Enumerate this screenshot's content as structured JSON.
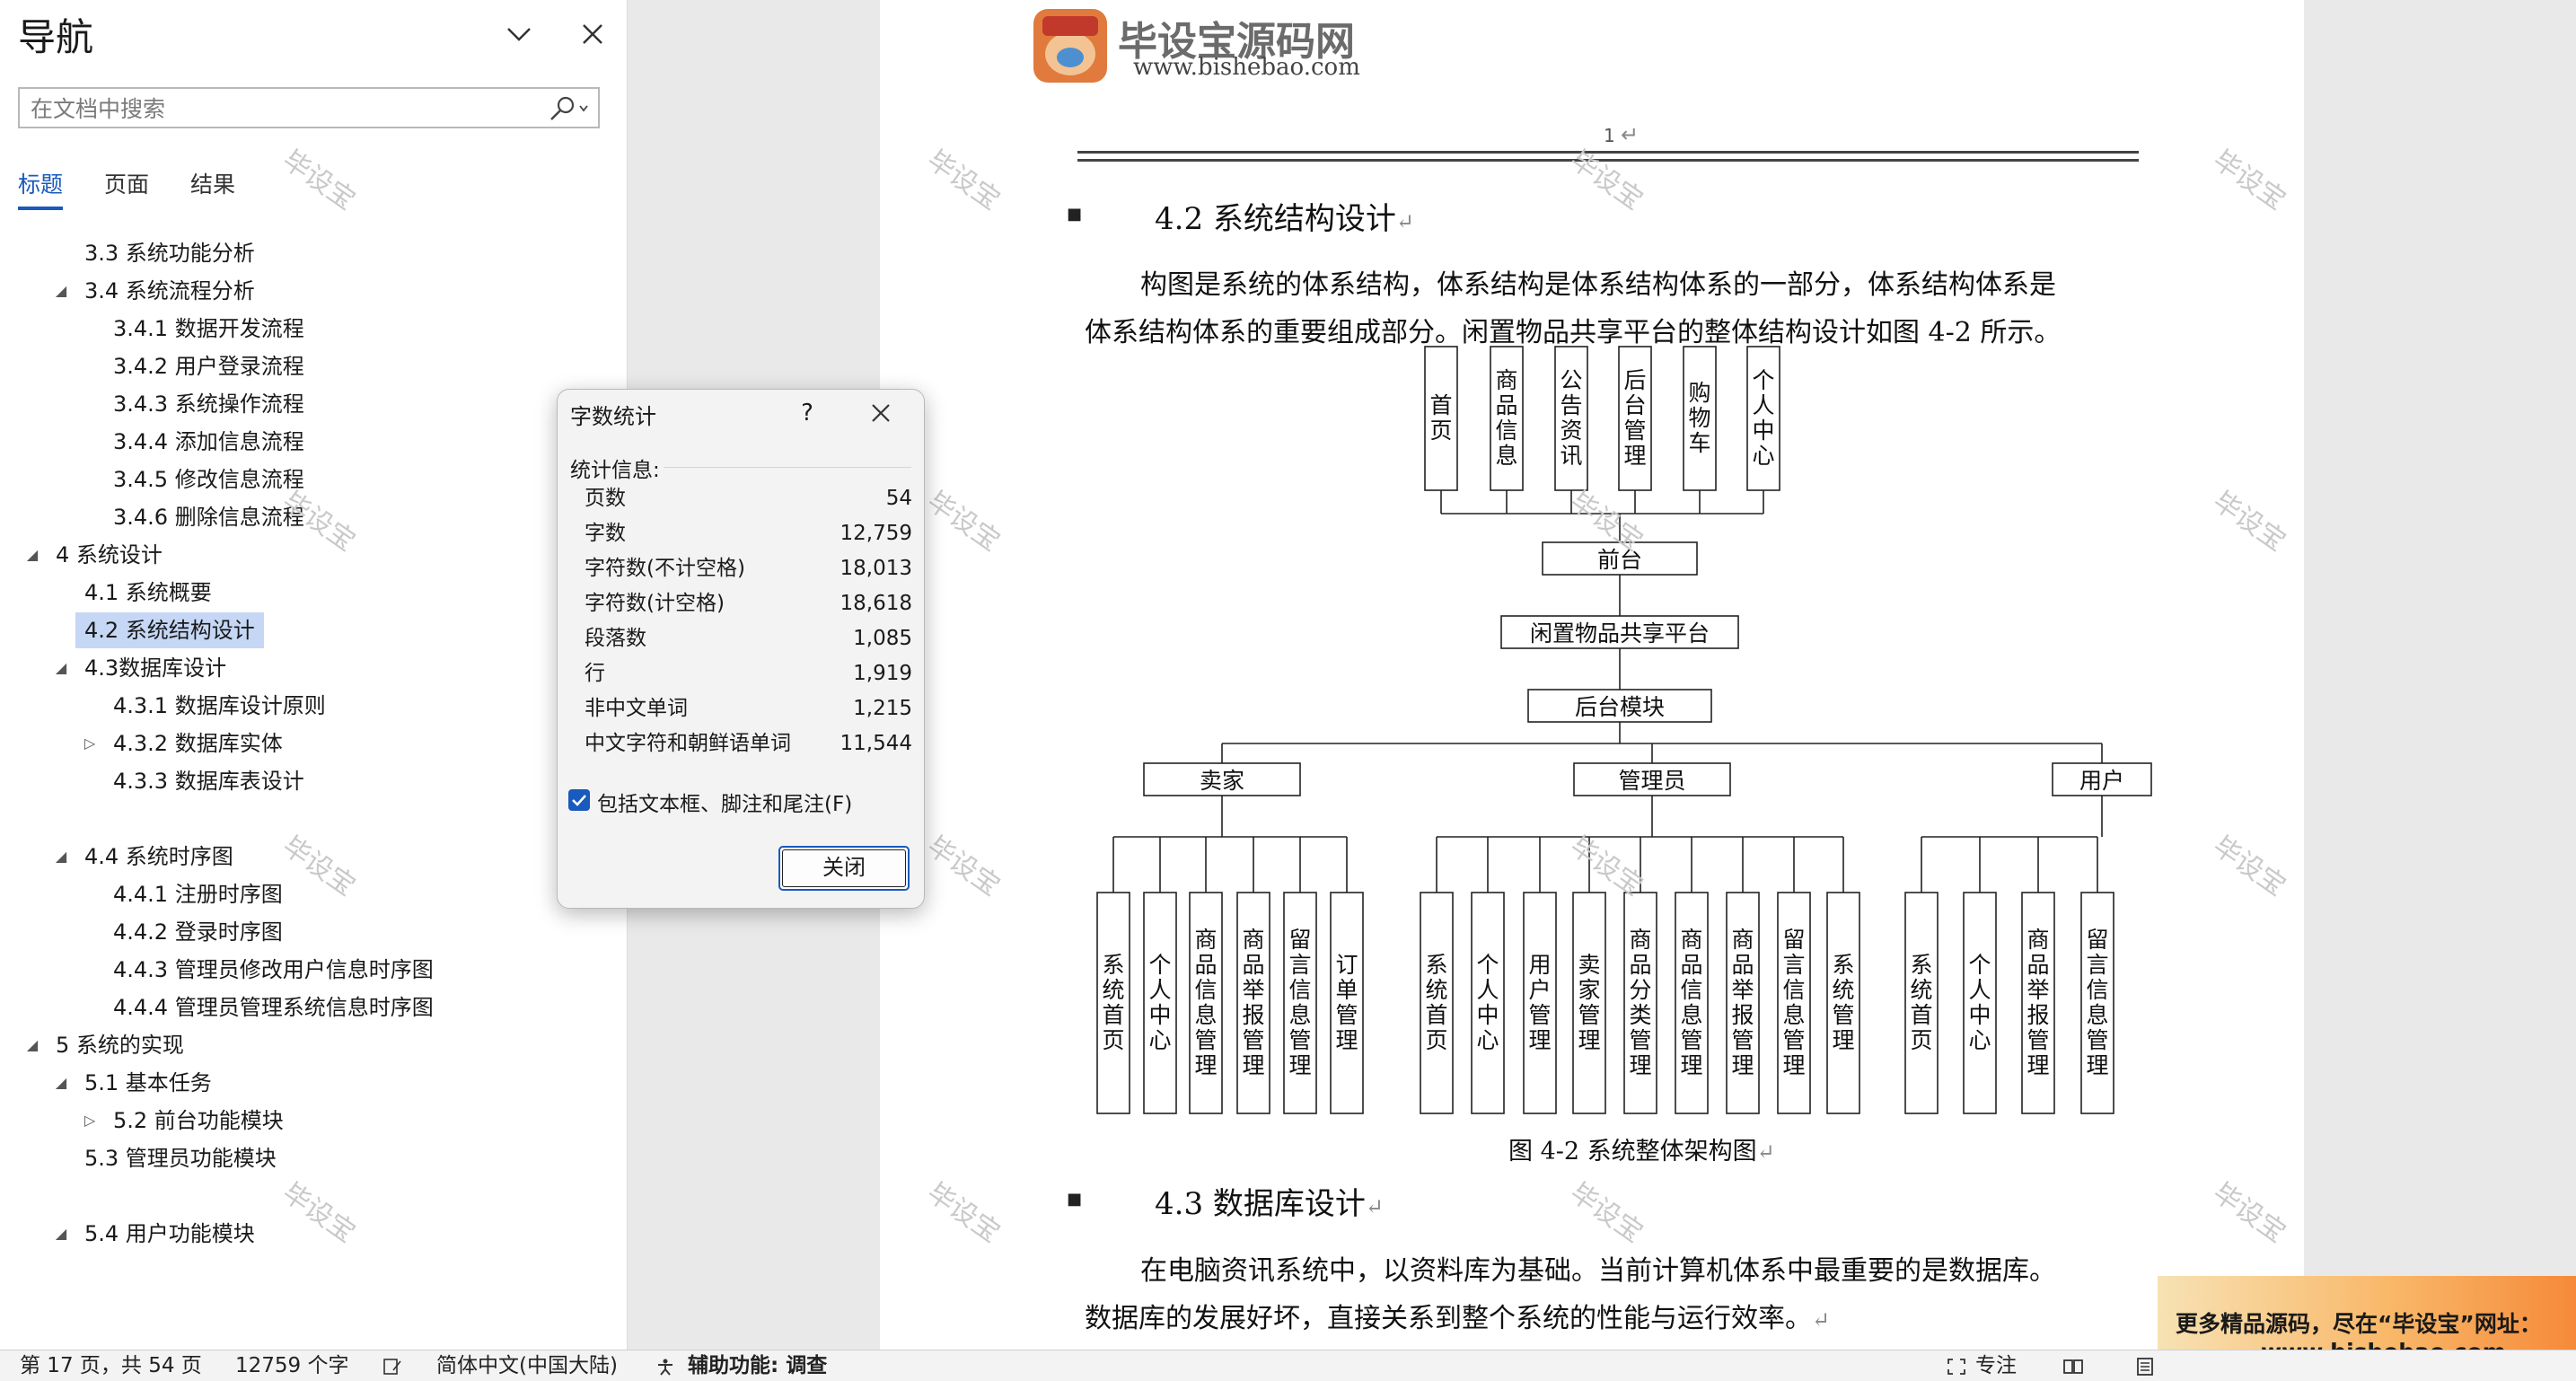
{
  "nav": {
    "title": "导航",
    "search_placeholder": "在文档中搜索",
    "tabs": [
      "标题",
      "页面",
      "结果"
    ],
    "outline": [
      {
        "label": "3.3 系统功能分析",
        "level": 2,
        "arrow": ""
      },
      {
        "label": "3.4 系统流程分析",
        "level": 2,
        "arrow": "expanded"
      },
      {
        "label": "3.4.1 数据开发流程",
        "level": 3,
        "arrow": ""
      },
      {
        "label": "3.4.2 用户登录流程",
        "level": 3,
        "arrow": ""
      },
      {
        "label": "3.4.3 系统操作流程",
        "level": 3,
        "arrow": ""
      },
      {
        "label": "3.4.4 添加信息流程",
        "level": 3,
        "arrow": ""
      },
      {
        "label": "3.4.5 修改信息流程",
        "level": 3,
        "arrow": ""
      },
      {
        "label": "3.4.6 删除信息流程",
        "level": 3,
        "arrow": ""
      },
      {
        "label": "4 系统设计",
        "level": 1,
        "arrow": "expanded"
      },
      {
        "label": "4.1 系统概要",
        "level": 2,
        "arrow": ""
      },
      {
        "label": "4.2 系统结构设计",
        "level": 2,
        "arrow": "",
        "selected": true
      },
      {
        "label": "4.3数据库设计",
        "level": 2,
        "arrow": "expanded"
      },
      {
        "label": "4.3.1 数据库设计原则",
        "level": 3,
        "arrow": ""
      },
      {
        "label": "4.3.2 数据库实体",
        "level": 3,
        "arrow": "collapsed"
      },
      {
        "label": "4.3.3 数据库表设计",
        "level": 3,
        "arrow": ""
      },
      {
        "label": "",
        "level": 2,
        "arrow": ""
      },
      {
        "label": "4.4 系统时序图",
        "level": 2,
        "arrow": "expanded"
      },
      {
        "label": "4.4.1 注册时序图",
        "level": 3,
        "arrow": ""
      },
      {
        "label": "4.4.2 登录时序图",
        "level": 3,
        "arrow": ""
      },
      {
        "label": "4.4.3 管理员修改用户信息时序图",
        "level": 3,
        "arrow": ""
      },
      {
        "label": "4.4.4 管理员管理系统信息时序图",
        "level": 3,
        "arrow": ""
      },
      {
        "label": "5 系统的实现",
        "level": 1,
        "arrow": "expanded"
      },
      {
        "label": "5.1 基本任务",
        "level": 2,
        "arrow": "expanded"
      },
      {
        "label": "5.2 前台功能模块",
        "level": 3,
        "arrow": "collapsed"
      },
      {
        "label": "5.3 管理员功能模块",
        "level": 2,
        "arrow": ""
      },
      {
        "label": "",
        "level": 2,
        "arrow": ""
      },
      {
        "label": "5.4 用户功能模块",
        "level": 2,
        "arrow": "expanded"
      }
    ]
  },
  "page": {
    "logo_title": "毕设宝源码网",
    "logo_url": "www.bishebao.com",
    "logo_badge": "毕设宝",
    "page_number": "1",
    "heading_42": "4.2  系统结构设计",
    "para1_line1": "构图是系统的体系结构，体系结构是体系结构体系的一部分，体系结构体系是",
    "para1_line2": "体系结构体系的重要组成部分。闲置物品共享平台的整体结构设计如图 4-2 所示。",
    "caption": "图 4-2  系统整体架构图",
    "heading_43": "4.3 数据库设计",
    "para2_line1": "在电脑资讯系统中，以资料库为基础。当前计算机体系中最重要的是数据库。",
    "para2_line2": "数据库的发展好坏，直接关系到整个系统的性能与运行效率。",
    "watermark": "毕设宝",
    "para_mark": "↵"
  },
  "diagram": {
    "front_modules": [
      "首页",
      "商品信息",
      "公告资讯",
      "后台管理",
      "购物车",
      "个人中心"
    ],
    "front": "前台",
    "platform": "闲置物品共享平台",
    "backend": "后台模块",
    "roles": [
      {
        "name": "卖家",
        "modules": [
          "系统首页",
          "个人中心",
          "商品信息管理",
          "商品举报管理",
          "留言信息管理",
          "订单管理"
        ]
      },
      {
        "name": "管理员",
        "modules": [
          "系统首页",
          "个人中心",
          "用户管理",
          "卖家管理",
          "商品分类管理",
          "商品信息管理",
          "商品举报管理",
          "留言信息管理",
          "系统管理"
        ]
      },
      {
        "name": "用户",
        "modules": [
          "系统首页",
          "个人中心",
          "商品举报管理",
          "留言信息管理"
        ]
      }
    ]
  },
  "dialog": {
    "title": "字数统计",
    "help": "?",
    "stats_label": "统计信息:",
    "stats": [
      {
        "name": "页数",
        "value": "54"
      },
      {
        "name": "字数",
        "value": "12,759"
      },
      {
        "name": "字符数(不计空格)",
        "value": "18,013"
      },
      {
        "name": "字符数(计空格)",
        "value": "18,618"
      },
      {
        "name": "段落数",
        "value": "1,085"
      },
      {
        "name": "行",
        "value": "1,919"
      },
      {
        "name": "非中文单词",
        "value": "1,215"
      },
      {
        "name": "中文字符和朝鲜语单词",
        "value": "11,544"
      }
    ],
    "checkbox_label": "包括文本框、脚注和尾注(F)",
    "checkbox_checked": true,
    "close_button": "关闭"
  },
  "ad": {
    "line1": "更多精品源码，尽在“毕设宝”网址：",
    "line2": "www.bishebao.com"
  },
  "status": {
    "page_info": "第 17 页，共 54 页",
    "word_count": "12759 个字",
    "language": "简体中文(中国大陆)",
    "accessibility": "辅助功能: 调查",
    "focus": "专注"
  },
  "colors": {
    "accent": "#185abd",
    "selection": "#c5d7f5",
    "ad_orange": "#f58a3a"
  }
}
